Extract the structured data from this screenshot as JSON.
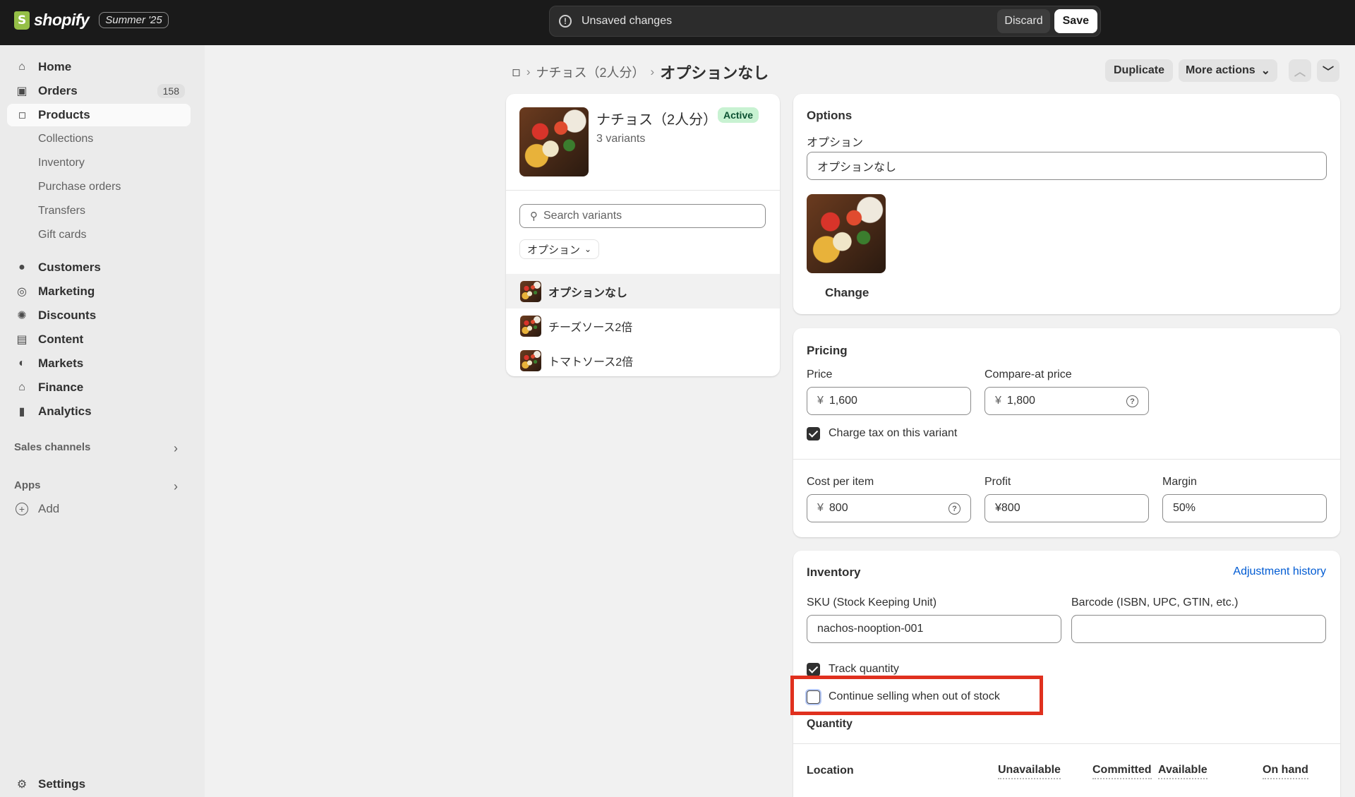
{
  "topbar": {
    "brand": "shopify",
    "edition": "Summer '25",
    "unsaved_text": "Unsaved changes",
    "discard_label": "Discard",
    "save_label": "Save"
  },
  "sidebar": {
    "home": "Home",
    "orders": "Orders",
    "orders_count": "158",
    "products": "Products",
    "sub": [
      "Collections",
      "Inventory",
      "Purchase orders",
      "Transfers",
      "Gift cards"
    ],
    "customers": "Customers",
    "marketing": "Marketing",
    "discounts": "Discounts",
    "content": "Content",
    "markets": "Markets",
    "finance": "Finance",
    "analytics": "Analytics",
    "sales_channels": "Sales channels",
    "apps": "Apps",
    "add": "Add",
    "settings": "Settings"
  },
  "breadcrumb": {
    "parent": "ナチョス（2人分）",
    "current": "オプションなし"
  },
  "header_actions": {
    "duplicate": "Duplicate",
    "more_actions": "More actions"
  },
  "product_card": {
    "title": "ナチョス（2人分）",
    "status": "Active",
    "variant_count": "3 variants",
    "search_placeholder": "Search variants",
    "filter_label": "オプション",
    "variants": [
      "オプションなし",
      "チーズソース2倍",
      "トマトソース2倍"
    ]
  },
  "options": {
    "title": "Options",
    "label": "オプション",
    "value": "オプションなし",
    "change": "Change"
  },
  "pricing": {
    "title": "Pricing",
    "price_label": "Price",
    "price_prefix": "¥",
    "price": "1,600",
    "compare_label": "Compare-at price",
    "compare_prefix": "¥",
    "compare": "1,800",
    "charge_tax": "Charge tax on this variant",
    "cost_label": "Cost per item",
    "cost_prefix": "¥",
    "cost": "800",
    "profit_label": "Profit",
    "profit": "¥800",
    "margin_label": "Margin",
    "margin": "50%"
  },
  "inventory": {
    "title": "Inventory",
    "adjustment_history": "Adjustment history",
    "sku_label": "SKU (Stock Keeping Unit)",
    "sku": "nachos-nooption-001",
    "barcode_label": "Barcode (ISBN, UPC, GTIN, etc.)",
    "barcode": "",
    "track_quantity": "Track quantity",
    "continue_selling": "Continue selling when out of stock",
    "quantity_label": "Quantity",
    "columns": {
      "location": "Location",
      "unavailable": "Unavailable",
      "committed": "Committed",
      "available": "Available",
      "on_hand": "On hand"
    }
  },
  "colors": {
    "highlight": "#e0301e",
    "link": "#005bd3",
    "active_badge": "#c8f2d2"
  }
}
